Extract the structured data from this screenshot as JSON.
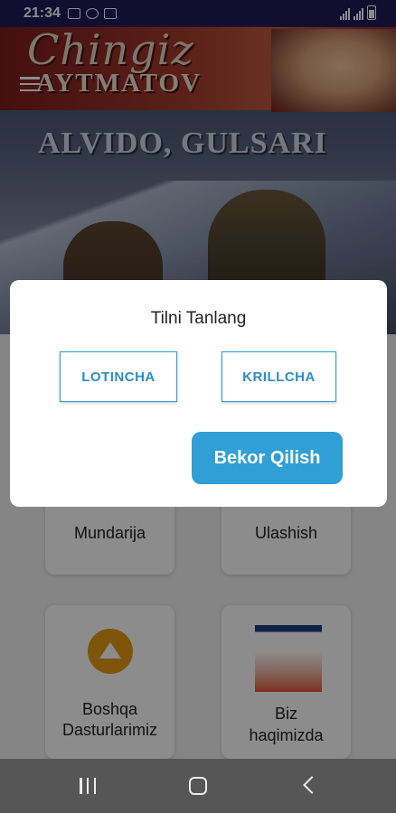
{
  "status_bar": {
    "time": "21:34"
  },
  "hero": {
    "author_signature": "Chingiz",
    "author_surname": "AYTMATOV",
    "book_title": "ALVIDO, GULSARI"
  },
  "cards": [
    {
      "label": "Mundarija"
    },
    {
      "label": "Ulashish"
    },
    {
      "label_line1": "Boshqa",
      "label_line2": "Dasturlarimiz"
    },
    {
      "label_line1": "Biz",
      "label_line2": "haqimizda"
    }
  ],
  "dialog": {
    "title": "Tilni Tanlang",
    "latin_button": "LOTINCHA",
    "cyrillic_button": "KRILLCHA",
    "cancel_button": "Bekor Qilish"
  },
  "colors": {
    "accent": "#2f9fd6",
    "status_bar": "#1f1a5a",
    "icon_orange": "#e89a14"
  }
}
